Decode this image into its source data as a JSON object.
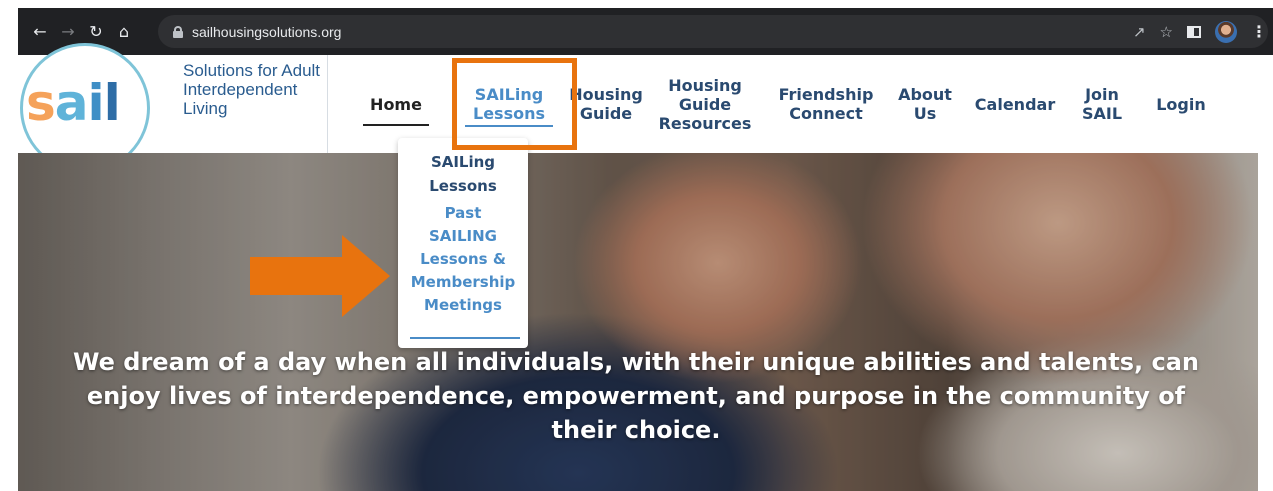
{
  "browser": {
    "back_icon": "back-arrow-icon",
    "forward_icon": "forward-arrow-icon",
    "reload_icon": "reload-icon",
    "home_icon": "home-icon",
    "url": "sailhousingsolutions.org"
  },
  "logo": {
    "text_s": "s",
    "text_a": "a",
    "text_i": "i",
    "text_l": "l"
  },
  "header": {
    "tagline": "Solutions for Adult Interdependent Living"
  },
  "nav": {
    "home": "Home",
    "sailing_line1": "SAILing",
    "sailing_line2": "Lessons",
    "housing_line1": "Housing",
    "housing_line2": "Guide",
    "resources_line1": "Housing",
    "resources_line2": "Guide",
    "resources_line3": "Resources",
    "friend_line1": "Friendship",
    "friend_line2": "Connect",
    "about_line1": "About",
    "about_line2": "Us",
    "calendar": "Calendar",
    "join_line1": "Join",
    "join_line2": "SAIL",
    "login": "Login"
  },
  "dropdown": {
    "current_line1": "SAILing",
    "current_line2": "Lessons",
    "link_line1": "Past",
    "link_line2": "SAILING",
    "link_line3": "Lessons &",
    "link_line4": "Membership",
    "link_line5": "Meetings"
  },
  "hero": {
    "line1": "We dream of a day when all individuals, with their unique abilities and talents, can",
    "line2": "enjoy lives of interdependence, empowerment, and purpose in the community of",
    "line3": "their choice."
  },
  "colors": {
    "highlight": "#e8730e",
    "nav_active": "#4a8cc7",
    "nav_text": "#2a4a70"
  }
}
